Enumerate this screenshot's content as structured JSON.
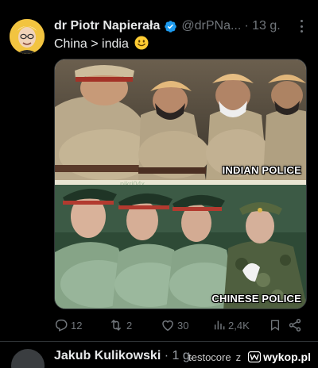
{
  "tweet": {
    "author_name": "dr Piotr Napierała",
    "handle": "@drPNa...",
    "time": "· 13 g.",
    "text": "China > india",
    "emoji": "slightly-smiling-face-emoji"
  },
  "media": {
    "top_caption": "INDIAN POLICE",
    "bottom_caption": "CHINESE POLICE",
    "watermark": "pikri04x"
  },
  "actions": {
    "replies": "12",
    "retweets": "2",
    "likes": "30",
    "views": "2,4K"
  },
  "next_tweet": {
    "author_partial": "Jakub Kulikowski",
    "suffix_partial": "· 1 g."
  },
  "footer": {
    "user": "testocore",
    "separator": "z",
    "site": "wykop.pl"
  },
  "colors": {
    "background": "#000000",
    "text_primary": "#e7e9ea",
    "text_secondary": "#71767b",
    "verified_blue": "#1d9bf0",
    "divider": "#2f3336"
  }
}
